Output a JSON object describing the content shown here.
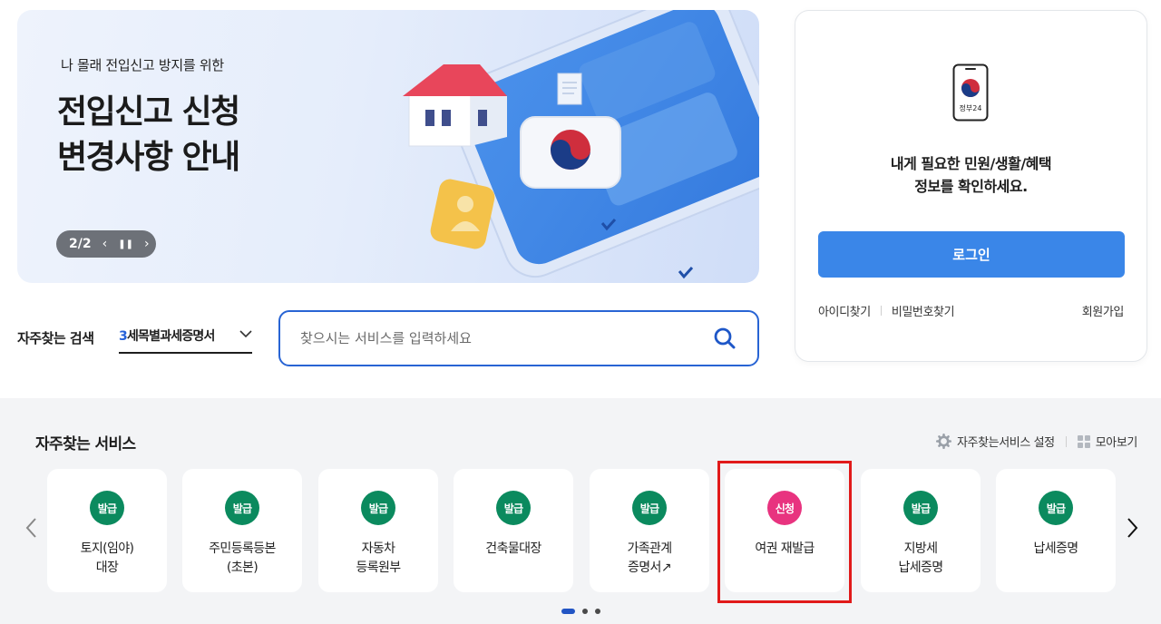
{
  "banner": {
    "subtitle": "나 몰래 전입신고 방지를 위한",
    "title_line1": "전입신고 신청",
    "title_line2": "변경사항 안내",
    "pager": {
      "current": "2/2",
      "prev_icon": "chevron-left-icon",
      "pause_icon": "pause-icon",
      "next_icon": "chevron-right-icon"
    }
  },
  "search": {
    "frequent_label": "자주찾는 검색",
    "select_rank": "3",
    "select_value": "세목별과세증명서",
    "placeholder": "찾으시는 서비스를 입력하세요",
    "accent": "#2864d4"
  },
  "login": {
    "logo_text": "정부24",
    "message_line1": "내게 필요한 민원/생활/혜택",
    "message_line2": "정보를 확인하세요.",
    "button": "로그인",
    "links": [
      "아이디찾기",
      "비밀번호찾기"
    ],
    "signup": "회원가입",
    "button_color": "#3a86e8"
  },
  "services": {
    "title": "자주찾는 서비스",
    "settings_label": "자주찾는서비스 설정",
    "collect_label": "모아보기",
    "items": [
      {
        "badge": "발급",
        "type": "green",
        "line1": "토지(임야)",
        "line2": "대장"
      },
      {
        "badge": "발급",
        "type": "green",
        "line1": "주민등록등본",
        "line2": "(초본)"
      },
      {
        "badge": "발급",
        "type": "green",
        "line1": "자동차",
        "line2": "등록원부"
      },
      {
        "badge": "발급",
        "type": "green",
        "line1": "건축물대장",
        "line2": ""
      },
      {
        "badge": "발급",
        "type": "green",
        "line1": "가족관계",
        "line2": "증명서↗"
      },
      {
        "badge": "신청",
        "type": "pink",
        "line1": "여권 재발급",
        "line2": ""
      },
      {
        "badge": "발급",
        "type": "green",
        "line1": "지방세",
        "line2": "납세증명"
      },
      {
        "badge": "발급",
        "type": "green",
        "line1": "납세증명",
        "line2": ""
      }
    ],
    "page_dots": 3,
    "active_dot": 1
  }
}
